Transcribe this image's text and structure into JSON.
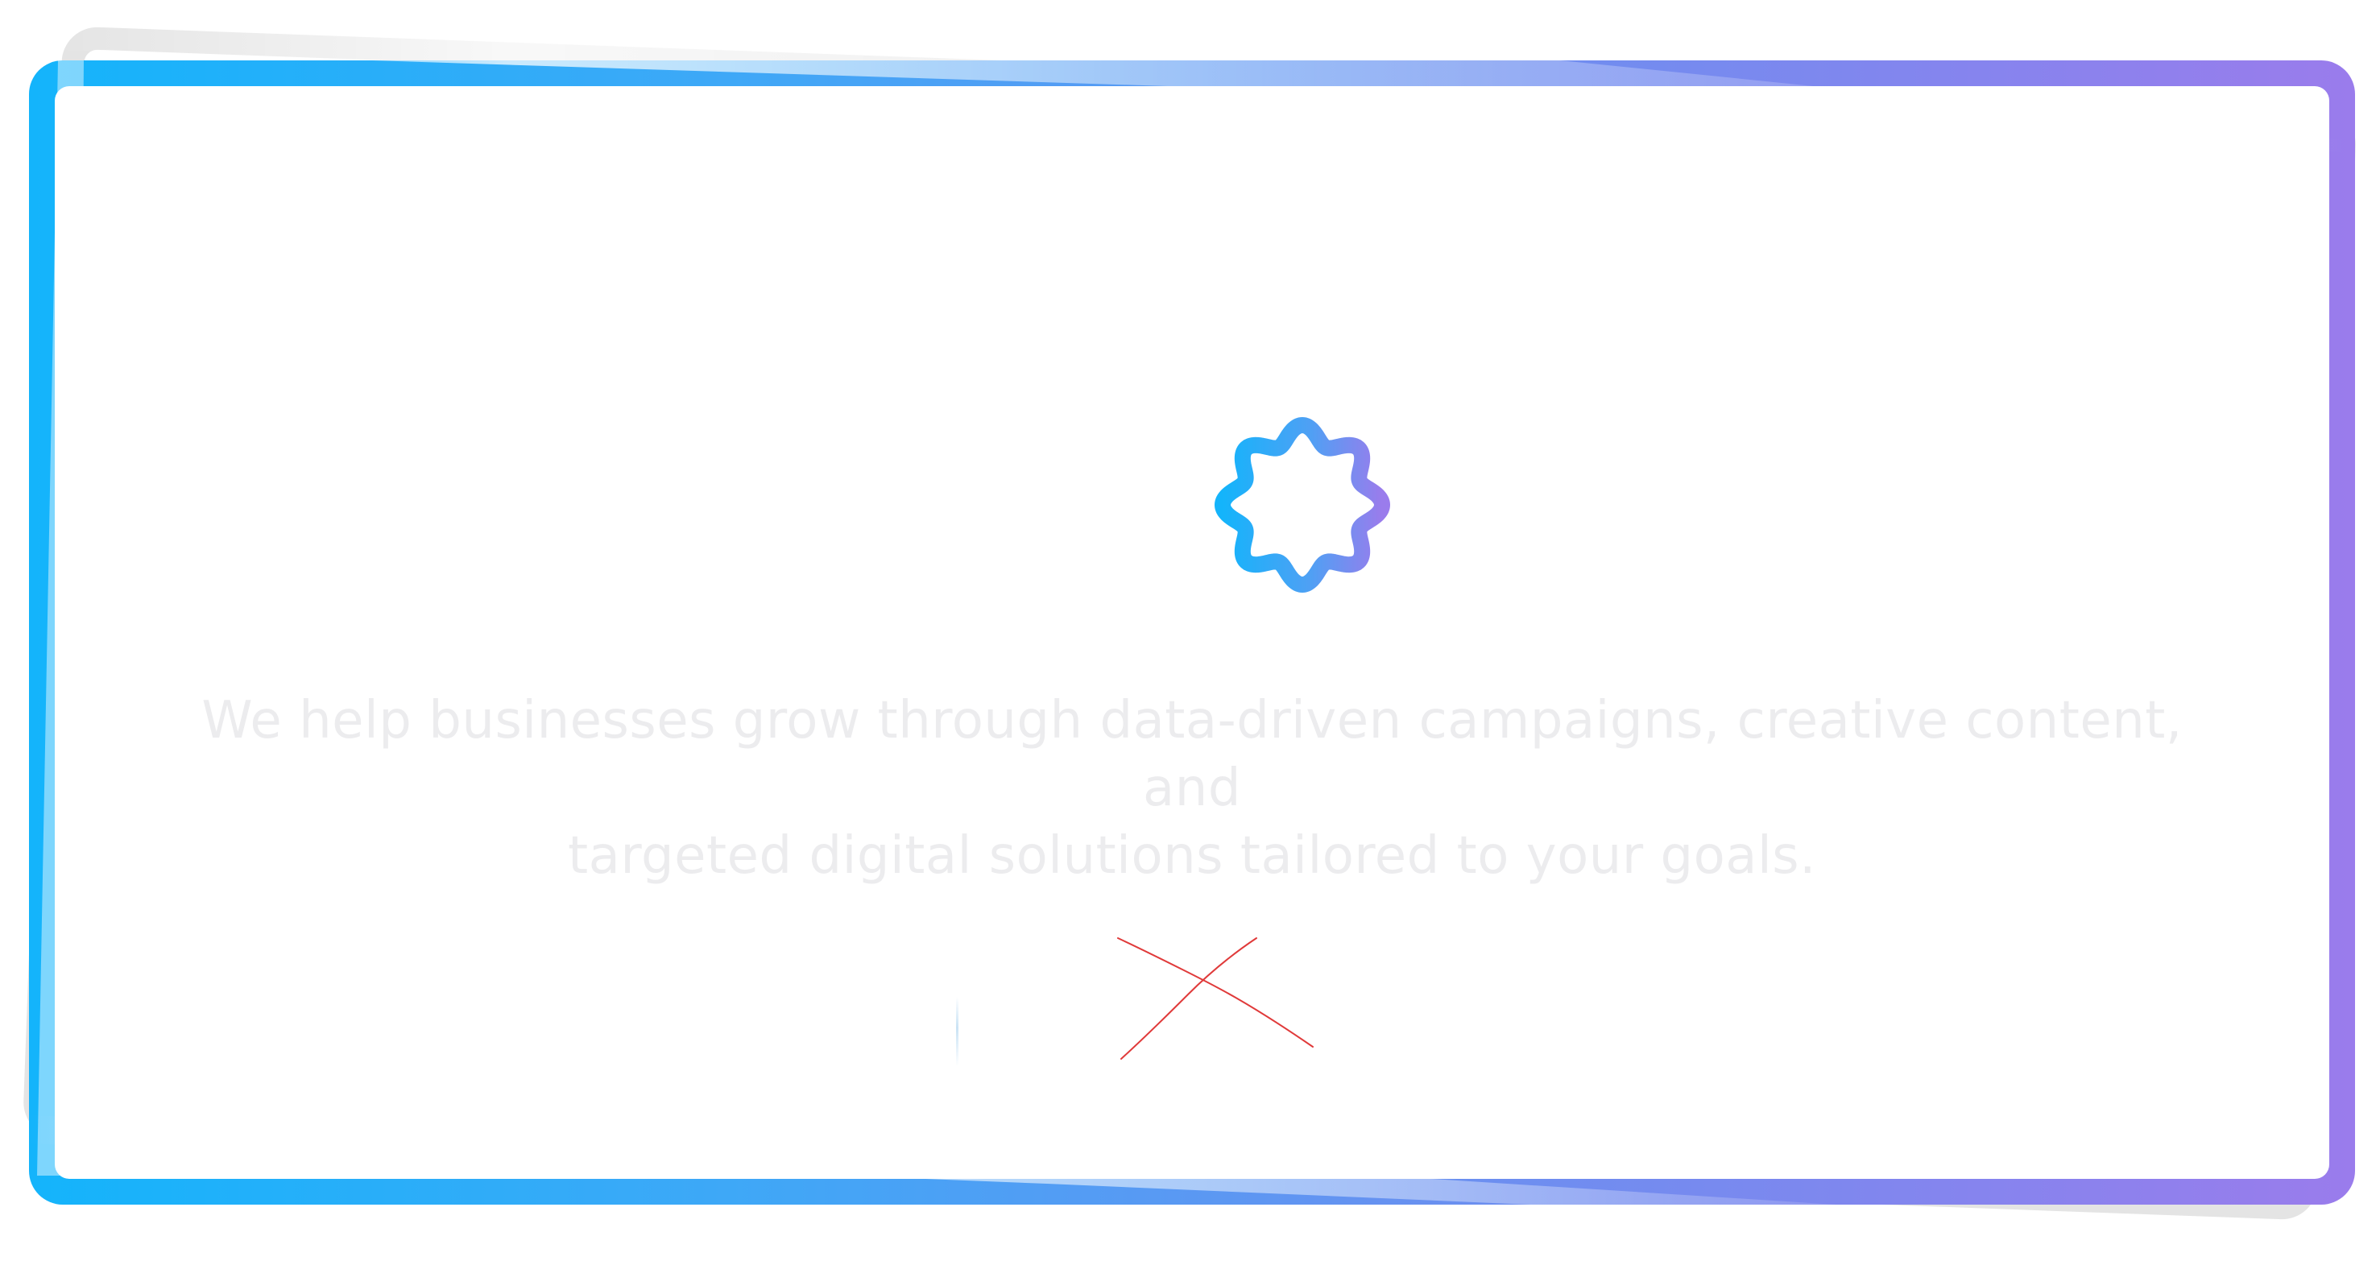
{
  "hero": {
    "tagline_line1": "We help businesses grow through data-driven campaigns, creative content, and",
    "tagline_line2": "targeted digital solutions tailored to your goals."
  },
  "logo": {
    "icon": "flower-ring-icon",
    "gradient_start": "#14b4fb",
    "gradient_end": "#9a7cec"
  },
  "frame": {
    "gradient_start": "#14b4fb",
    "gradient_end": "#9a7cec",
    "shadow_color": "#cdcdcd"
  },
  "marks": {
    "cross_color": "#e03a3a"
  }
}
